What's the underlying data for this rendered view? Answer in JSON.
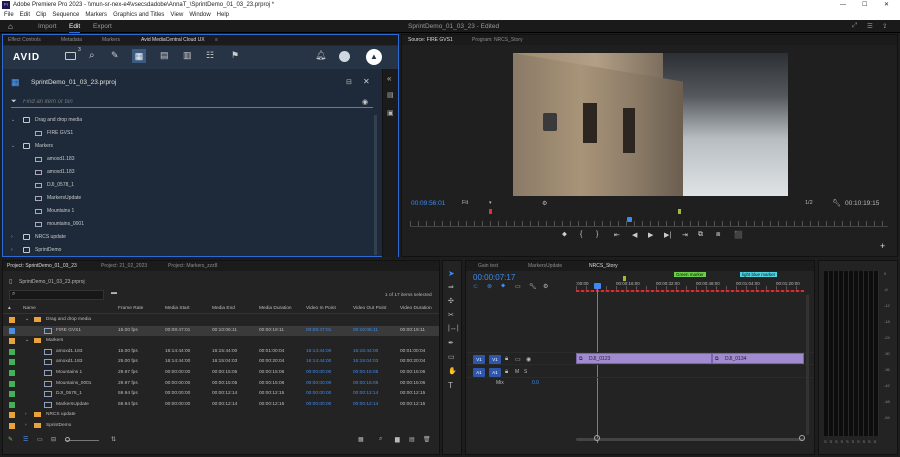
{
  "app": {
    "title": "Adobe Premiere Pro 2023 - \\\\mun-sr-nex-e4\\vsecsdadobe\\AnnaT_\\SprintDemo_01_03_23.prproj *",
    "menu": [
      "File",
      "Edit",
      "Clip",
      "Sequence",
      "Markers",
      "Graphics and Titles",
      "View",
      "Window",
      "Help"
    ],
    "workspace_tabs": [
      "Import",
      "Edit",
      "Export"
    ],
    "sequence_title": "SprintDemo_01_03_23 - Edited",
    "accent": "#2a6bd6",
    "clip_color": "#a08ad0"
  },
  "top_left_tabs": [
    "Effect Controls",
    "Metadata",
    "Markers",
    "Avid MediaCentral Cloud UX"
  ],
  "avid": {
    "logo": "AVID",
    "badge": "3",
    "project_name": "SprintDemo_01_03_23.prproj",
    "search_placeholder": "Find an item or bin",
    "tree": [
      {
        "label": "Drag and drop media",
        "level": 0,
        "type": "folder",
        "open": true
      },
      {
        "label": "FIRE GVS1",
        "level": 1,
        "type": "clip"
      },
      {
        "label": "Markers",
        "level": 0,
        "type": "folder",
        "open": true
      },
      {
        "label": "amoxd1.183",
        "level": 1,
        "type": "seq"
      },
      {
        "label": "amoxd1.183",
        "level": 1,
        "type": "seq"
      },
      {
        "label": "DJI_0578_1",
        "level": 1,
        "type": "seq"
      },
      {
        "label": "MarkersUpdate",
        "level": 1,
        "type": "seq"
      },
      {
        "label": "Mountains 1",
        "level": 1,
        "type": "seq"
      },
      {
        "label": "mountains_0001",
        "level": 1,
        "type": "seq"
      },
      {
        "label": "NRCS update",
        "level": 0,
        "type": "folder",
        "open": false
      },
      {
        "label": "SprintDemo",
        "level": 0,
        "type": "folder",
        "open": false
      }
    ]
  },
  "monitor": {
    "tabs": [
      "Source: FIRE GVS1",
      "Program: NRCS_Story"
    ],
    "timecode_left": "00:09:56:01",
    "fit": "Fit",
    "ratio": "1/2",
    "timecode_right": "00:10:19:15"
  },
  "project": {
    "tabs": [
      "Project: SprintDemo_01_03_23",
      "Project: 21_02_2023",
      "Project: Markers_zzz8"
    ],
    "path": "SprintDemo_01_03_23.prproj",
    "selection": "1 of 17 items selected",
    "columns": [
      "Name",
      "Frame Rate",
      "Media Start",
      "Media End",
      "Media Duration",
      "Video In Point",
      "Video Out Point",
      "Video Duration"
    ],
    "rows": [
      {
        "name": "Drag and drop media",
        "type": "folder",
        "color": "#e8a33a",
        "cells": [
          "",
          "",
          "",
          "",
          "",
          "",
          ""
        ]
      },
      {
        "name": "FIRE GVS1",
        "type": "clip",
        "color": "#4a8fe0",
        "cells": [
          "15.00 fps",
          "00:09:47:01",
          "00:10:06:11",
          "00:00:19:11",
          "00:09:47:01",
          "00:10:06:11",
          "00:00:19:11"
        ],
        "selected": true
      },
      {
        "name": "Markers",
        "type": "folder",
        "color": "#e8a33a",
        "cells": [
          "",
          "",
          "",
          "",
          "",
          "",
          ""
        ]
      },
      {
        "name": "amoxd1.183",
        "type": "seq",
        "color": "#45b05a",
        "cells": [
          "15.00 fps",
          "16:14:44:00",
          "16:15:44:00",
          "00:01:00:04",
          "16:14:44:00",
          "16:15:44:00",
          "00:01:00:04"
        ]
      },
      {
        "name": "amoxd1.183",
        "type": "seq",
        "color": "#45b05a",
        "cells": [
          "25.00 fps",
          "16:14:44:00",
          "16:15:04:03",
          "00:00:20:04",
          "16:14:44:00",
          "16:15:04:03",
          "00:00:20:04"
        ]
      },
      {
        "name": "Mountains 1",
        "type": "seq",
        "color": "#45b05a",
        "cells": [
          "29.97 fps",
          "00:00:00:00",
          "00:00:15:05",
          "00:00:15:06",
          "00:00:00:00",
          "00:00:15:05",
          "00:00:15:06"
        ]
      },
      {
        "name": "Mountains_0001",
        "type": "seq",
        "color": "#45b05a",
        "cells": [
          "29.97 fps",
          "00:00:00:00",
          "00:00:15:05",
          "00:00:15:06",
          "00:00:00:00",
          "00:00:15:05",
          "00:00:15:06"
        ]
      },
      {
        "name": "DJI_0578_1",
        "type": "seq",
        "color": "#45b05a",
        "cells": [
          "59.94 fps",
          "00:00:00:00",
          "00:00:12:14",
          "00:00:12:15",
          "00:00:00:00",
          "00:00:12:14",
          "00:00:12:15"
        ]
      },
      {
        "name": "MarkersUpdate",
        "type": "seq",
        "color": "#45b05a",
        "cells": [
          "59.94 fps",
          "00:00:00:00",
          "00:00:12:14",
          "00:00:12:15",
          "00:00:00:00",
          "00:00:12:14",
          "00:00:12:15"
        ]
      },
      {
        "name": "NRCS update",
        "type": "folder",
        "color": "#e8a33a",
        "cells": [
          "",
          "",
          "",
          "",
          "",
          "",
          ""
        ]
      },
      {
        "name": "SprintDemo",
        "type": "folder",
        "color": "#e8a33a",
        "cells": [
          "",
          "",
          "",
          "",
          "",
          "",
          ""
        ]
      }
    ]
  },
  "timeline": {
    "tabs": [
      "Gain test",
      "MarkersUpdate",
      "NRCS_Story"
    ],
    "timecode": "00:00:07:17",
    "ruler": [
      ":00:00",
      "00:00:16:00",
      "00:00:32:00",
      "00:00:48:00",
      "00:01:04:00",
      "00:01:20:00"
    ],
    "markers": [
      {
        "label": "Green marker",
        "color": "#6ad04a"
      },
      {
        "label": "light blue marker",
        "color": "#4fd3e0"
      }
    ],
    "tracks": [
      "V1",
      "A1"
    ],
    "mix_label": "Mix",
    "mix_value": "0.0",
    "clips": [
      "DJI_0123",
      "DJI_0134"
    ]
  },
  "meter": {
    "ticks": [
      "0",
      "-6",
      "-12",
      "-18",
      "-24",
      "-30",
      "-36",
      "-42",
      "-48",
      "-54"
    ],
    "bottom": [
      "S",
      "S",
      "S",
      "S",
      "S",
      "S",
      "S",
      "S",
      "S",
      "S"
    ]
  }
}
